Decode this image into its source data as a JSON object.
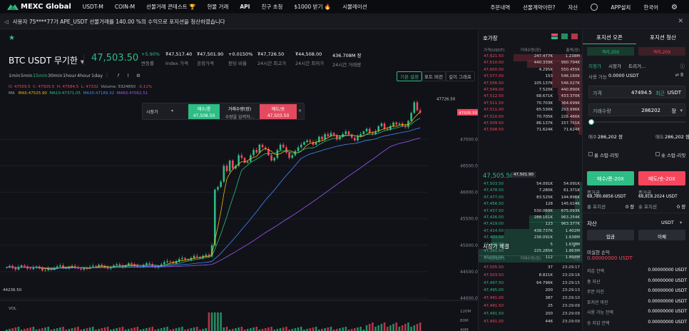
{
  "nav": {
    "brand": "MEXC Global",
    "items": [
      "USDT-M",
      "COIN-M",
      "선물거래 콘테스트 🏆",
      "현물 거래",
      "API",
      "친구 초청",
      "$1000 받기 🔥",
      "시뮬레이션"
    ],
    "right": [
      "주문내역",
      "선물계약이란?",
      "자산",
      "",
      "APP설치",
      "한국어",
      ""
    ]
  },
  "notice": "사용자 75****77가 APE_USDT 선물거래를 140.00 %의 수익으로 포지션을 청산하였습니다",
  "symbol": {
    "name": "BTC USDT 무기한",
    "price": "47,503.50"
  },
  "stats": [
    {
      "v": "+5.90%",
      "l": "변동률",
      "c": "#2dbd85"
    },
    {
      "v": "₮47,517.40",
      "l": "Index 가격",
      "c": "#ffffff"
    },
    {
      "v": "₮47,501.90",
      "l": "공정가격",
      "c": "#ffffff"
    },
    {
      "v": "+0.0150%",
      "l": "펀딩 비율",
      "c": "#ffffff"
    },
    {
      "v": "₮47,726.50",
      "l": "24시간 최고가",
      "c": "#ffffff"
    },
    {
      "v": "₮44,508.00",
      "l": "24시간 최저가",
      "c": "#ffffff"
    },
    {
      "v": "436.708M 장",
      "l": "24시간 거래량",
      "c": "#ffffff"
    }
  ],
  "toolbar": {
    "intervals": [
      "1min",
      "5min",
      "15min",
      "30min",
      "1hour",
      "4hour",
      "1day"
    ],
    "active": "15min",
    "views": [
      "기본 설정",
      "표트 버전",
      "깊이 그래프"
    ]
  },
  "ohlc": {
    "o": "O: 47559.5",
    "c": "C: 47505.5",
    "h": "H: 47584.5",
    "l": "L: 47332",
    "vol": "Volume: 5324650",
    "chg": "-0.11%"
  },
  "ma": {
    "label": "MA",
    "ma5": "MA5:47525.90",
    "ma10": "MA10:47371.05",
    "ma30": "MA30:47189.32",
    "ma60": "MA60:47062.51"
  },
  "chart_data": {
    "type": "candlestick",
    "last_price": "47505.50",
    "high_label": "47726.50",
    "low_label": "44236.50",
    "y_ticks": [
      "47000.00",
      "46500.00",
      "46000.00",
      "45500.00",
      "45000.00",
      "44500.00",
      "44000.00"
    ],
    "ylim": [
      44000,
      47800
    ],
    "vol_label": "VOL",
    "vol_ticks": [
      "120M",
      "80M",
      "40M"
    ]
  },
  "quick": {
    "market": "시장가",
    "buy": "매수/롱",
    "buy_price": "47,508.50",
    "qty": "거래수량(장)",
    "qty_ph": "수량을 입력하...",
    "sell": "매도/숏",
    "sell_price": "47,503.50",
    "close": "✕"
  },
  "book": {
    "title": "호가창",
    "cols": [
      "가격(USDT)",
      "거래수량(장)",
      "총액(장)"
    ],
    "asks": [
      [
        "47,621.50",
        "247.477K",
        "1.238M"
      ],
      [
        "47,610.00",
        "440.339K",
        "990.794K"
      ],
      [
        "47,600.00",
        "4.295K",
        "550.455K"
      ],
      [
        "47,577.00",
        "153",
        "546.160K"
      ],
      [
        "47,556.50",
        "105.137K",
        "546.027K"
      ],
      [
        "47,549.00",
        "7.520K",
        "440.890K"
      ],
      [
        "47,512.50",
        "68.671K",
        "433.370K"
      ],
      [
        "47,511.50",
        "70.703K",
        "364.699K"
      ],
      [
        "47,511.00",
        "65.530K",
        "293.996K"
      ],
      [
        "47,510.00",
        "70.705K",
        "228.466K"
      ],
      [
        "47,509.50",
        "86.137K",
        "157.761K"
      ],
      [
        "47,508.50",
        "71.624K",
        "71.624K"
      ]
    ],
    "mid": "47,505.50",
    "mid_tag": "47,501.90",
    "bids": [
      [
        "47,503.50",
        "54.091K",
        "54.091K"
      ],
      [
        "47,478.50",
        "7.280K",
        "61.371K"
      ],
      [
        "47,477.00",
        "83.525K",
        "144.896K"
      ],
      [
        "47,456.50",
        "128",
        "145.024K"
      ],
      [
        "47,437.50",
        "530.069K",
        "675.093K"
      ],
      [
        "47,426.00",
        "288.161K",
        "963.254K"
      ],
      [
        "47,419.00",
        "123",
        "963.377K"
      ],
      [
        "47,414.50",
        "438.737K",
        "1.402M"
      ],
      [
        "47,403.00",
        "236.091K",
        "1.638M"
      ],
      [
        "47,400.00",
        "5",
        "1.638M"
      ],
      [
        "47,391.50",
        "225.285K",
        "1.863M"
      ],
      [
        "47,389.50",
        "112",
        "1.864M"
      ]
    ],
    "trades_title": "시장가 체결",
    "trade_cols": [
      "가격(USDT)",
      "거래수량(장)",
      "시간"
    ],
    "trades": [
      [
        "47,505.50",
        "37",
        "23:29:17",
        "s"
      ],
      [
        "47,503.50",
        "8.821K",
        "23:29:16",
        "s"
      ],
      [
        "47,497.50",
        "64.796K",
        "23:29:15",
        "b"
      ],
      [
        "47,495.00",
        "200",
        "23:29:13",
        "b"
      ],
      [
        "47,491.00",
        "387",
        "23:29:10",
        "s"
      ],
      [
        "47,491.50",
        "25",
        "23:29:09",
        "s"
      ],
      [
        "47,491.50",
        "200",
        "23:29:09",
        "b"
      ],
      [
        "47,491.00",
        "446",
        "23:29:09",
        "s"
      ]
    ]
  },
  "order": {
    "tab_open": "포지션 오픈",
    "tab_close": "포지션 청산",
    "lev_long": "격리,20X",
    "lev_short": "격리,20X",
    "types": [
      "지정가",
      "시장가",
      "트리거..."
    ],
    "avail_label": "사용 가능",
    "avail": "0.0000 USDT",
    "price_label": "가격",
    "price": "47494.5",
    "price_suffix": "최근",
    "price_unit": "USDT",
    "qty_label": "거래수량",
    "qty": "286202",
    "qty_unit": "장",
    "buy_label": "매수",
    "buy_qty": "286,202 장",
    "sell_label": "매도",
    "sell_qty": "286,202 장",
    "stop_long": "롱 스탑-리밋",
    "stop_short": "숏 스탑-리밋",
    "btn_long": "매수/롱-20X",
    "btn_short": "매도/숏-20X",
    "margin_label": "증거금",
    "margin_long": "68,780.6856 USDT",
    "margin_short": "68,818.2024 USDT",
    "pos_long": "롱 포지션",
    "pos_short": "숏 포지션",
    "pos_val": "0 장",
    "asset_title": "자산",
    "asset_unit": "USDT",
    "deposit": "입금",
    "transfer": "이체",
    "unreal_label": "미실현 손익",
    "unreal": "0.00000000 USDT",
    "assets": [
      [
        "지갑 잔액",
        "0.00000000 USDT"
      ],
      [
        "총 자산",
        "0.00000000 USDT"
      ],
      [
        "주문 마진",
        "0.00000000 USDT"
      ],
      [
        "포지션 마진",
        "0.00000000 USDT"
      ],
      [
        "사용 가능 잔액",
        "0.00000000 USDT"
      ],
      [
        "송 지갑 잔액",
        "0.00000000 USDT"
      ]
    ]
  },
  "colors": {
    "up": "#2dbd85",
    "down": "#f6465d",
    "accent": "#2dbd85"
  }
}
